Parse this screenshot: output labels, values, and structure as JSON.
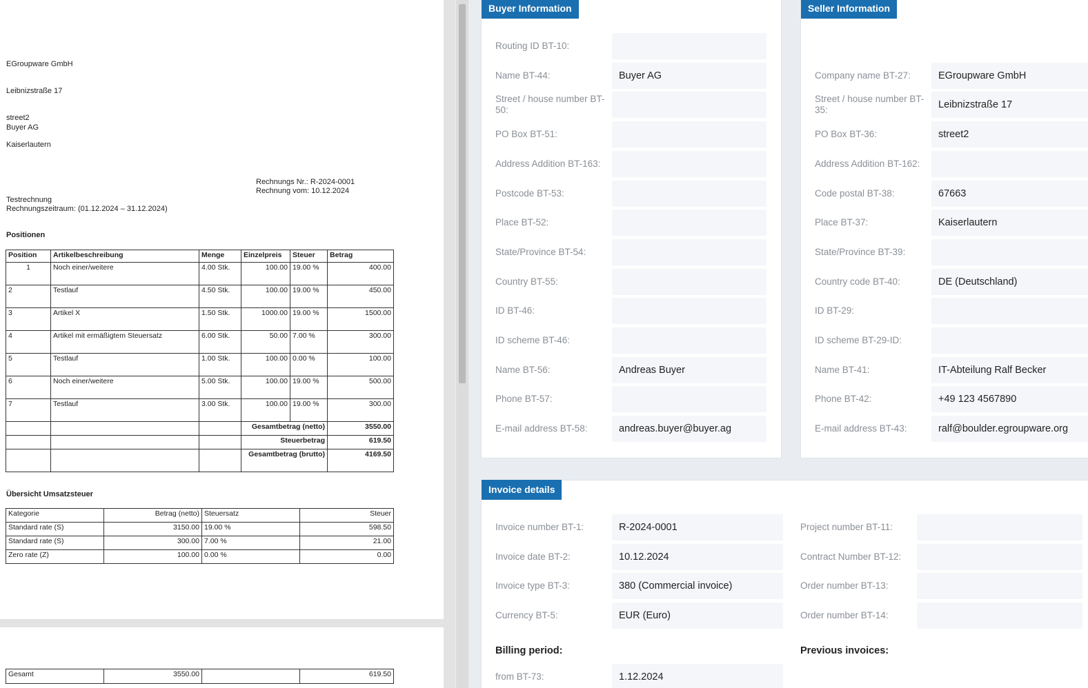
{
  "pdf": {
    "seller_address": [
      "EGroupware GmbH",
      "Leibnizstraße 17",
      "street2",
      "Kaiserlautern"
    ],
    "buyer_name": "Buyer AG",
    "invoice_no_line": "Rechnungs Nr.: R-2024-0001",
    "invoice_date_line": "Rechnung vom: 10.12.2024",
    "title": "Testrechnung",
    "period_line": "Rechnungszeitraum: (01.12.2024 – 31.12.2024)",
    "positions_heading": "Positionen",
    "positions_headers": [
      "Position",
      "Artikelbeschreibung",
      "Menge",
      "Einzelpreis",
      "Steuer",
      "Betrag"
    ],
    "positions": [
      [
        "1",
        "Noch einer/weitere",
        "4.00 Stk.",
        "100.00",
        "19.00 %",
        "400.00"
      ],
      [
        "2",
        "Testlauf",
        "4.50 Stk.",
        "100.00",
        "19.00 %",
        "450.00"
      ],
      [
        "3",
        "Artikel X",
        "1.50 Stk.",
        "1000.00",
        "19.00 %",
        "1500.00"
      ],
      [
        "4",
        "Artikel mit ermäßigtem Steuersatz",
        "6.00 Stk.",
        "50.00",
        "7.00 %",
        "300.00"
      ],
      [
        "5",
        "Testlauf",
        "1.00 Stk.",
        "100.00",
        "0.00 %",
        "100.00"
      ],
      [
        "6",
        "Noch einer/weitere",
        "5.00 Stk.",
        "100.00",
        "19.00 %",
        "500.00"
      ],
      [
        "7",
        "Testlauf",
        "3.00 Stk.",
        "100.00",
        "19.00 %",
        "300.00"
      ]
    ],
    "totals": [
      {
        "label": "Gesamtbetrag (netto)",
        "value": "3550.00"
      },
      {
        "label": "Steuerbetrag",
        "value": "619.50"
      },
      {
        "label": "Gesamtbetrag (brutto)",
        "value": "4169.50"
      }
    ],
    "vat_heading": "Übersicht Umsatzsteuer",
    "vat_headers": [
      "Kategorie",
      "Betrag (netto)",
      "Steuersatz",
      "Steuer"
    ],
    "vat_rows": [
      [
        "Standard rate (S)",
        "3150.00",
        "19.00 %",
        "598.50"
      ],
      [
        "Standard rate (S)",
        "300.00",
        "7.00 %",
        "21.00"
      ],
      [
        "Zero rate (Z)",
        "100.00",
        "0.00 %",
        "0.00"
      ]
    ],
    "page2_total": [
      "Gesamt",
      "3550.00",
      "",
      "619.50"
    ]
  },
  "buyer": {
    "title": "Buyer Information",
    "fields": [
      {
        "label": "Routing ID BT-10:",
        "value": ""
      },
      {
        "label": "Name BT-44:",
        "value": "Buyer AG"
      },
      {
        "label": "Street / house number BT-50:",
        "value": ""
      },
      {
        "label": "PO Box BT-51:",
        "value": ""
      },
      {
        "label": "Address Addition BT-163:",
        "value": ""
      },
      {
        "label": "Postcode BT-53:",
        "value": ""
      },
      {
        "label": "Place BT-52:",
        "value": ""
      },
      {
        "label": "State/Province BT-54:",
        "value": ""
      },
      {
        "label": "Country BT-55:",
        "value": ""
      },
      {
        "label": "ID BT-46:",
        "value": ""
      },
      {
        "label": "ID scheme BT-46:",
        "value": ""
      },
      {
        "label": "Name BT-56:",
        "value": "Andreas Buyer"
      },
      {
        "label": "Phone BT-57:",
        "value": ""
      },
      {
        "label": "E-mail address BT-58:",
        "value": "andreas.buyer@buyer.ag"
      }
    ]
  },
  "seller": {
    "title": "Seller Information",
    "fields": [
      {
        "label": "Company name BT-27:",
        "value": "EGroupware GmbH"
      },
      {
        "label": "Street / house number BT-35:",
        "value": "Leibnizstraße 17"
      },
      {
        "label": "PO Box BT-36:",
        "value": "street2"
      },
      {
        "label": "Address Addition BT-162:",
        "value": ""
      },
      {
        "label": "Code postal BT-38:",
        "value": "67663"
      },
      {
        "label": "Place BT-37:",
        "value": "Kaiserlautern"
      },
      {
        "label": "State/Province BT-39:",
        "value": ""
      },
      {
        "label": "Country code BT-40:",
        "value": "DE (Deutschland)"
      },
      {
        "label": "ID BT-29:",
        "value": ""
      },
      {
        "label": "ID scheme BT-29-ID:",
        "value": ""
      },
      {
        "label": "Name BT-41:",
        "value": "IT-Abteilung Ralf Becker"
      },
      {
        "label": "Phone BT-42:",
        "value": "+49 123 4567890"
      },
      {
        "label": "E-mail address BT-43:",
        "value": "ralf@boulder.egroupware.org"
      }
    ]
  },
  "invoice": {
    "title": "Invoice details",
    "left_fields": [
      {
        "label": "Invoice number BT-1:",
        "value": "R-2024-0001"
      },
      {
        "label": "Invoice date BT-2:",
        "value": "10.12.2024"
      },
      {
        "label": "Invoice type BT-3:",
        "value": "380 (Commercial invoice)"
      },
      {
        "label": "Currency BT-5:",
        "value": "EUR (Euro)"
      }
    ],
    "right_fields": [
      {
        "label": "Project number BT-11:",
        "value": ""
      },
      {
        "label": "Contract Number BT-12:",
        "value": ""
      },
      {
        "label": "Order number BT-13:",
        "value": ""
      },
      {
        "label": "Order number BT-14:",
        "value": ""
      }
    ],
    "billing_period_label": "Billing period:",
    "previous_invoices_label": "Previous invoices:",
    "from_field": {
      "label": "from BT-73:",
      "value": "1.12.2024"
    }
  }
}
